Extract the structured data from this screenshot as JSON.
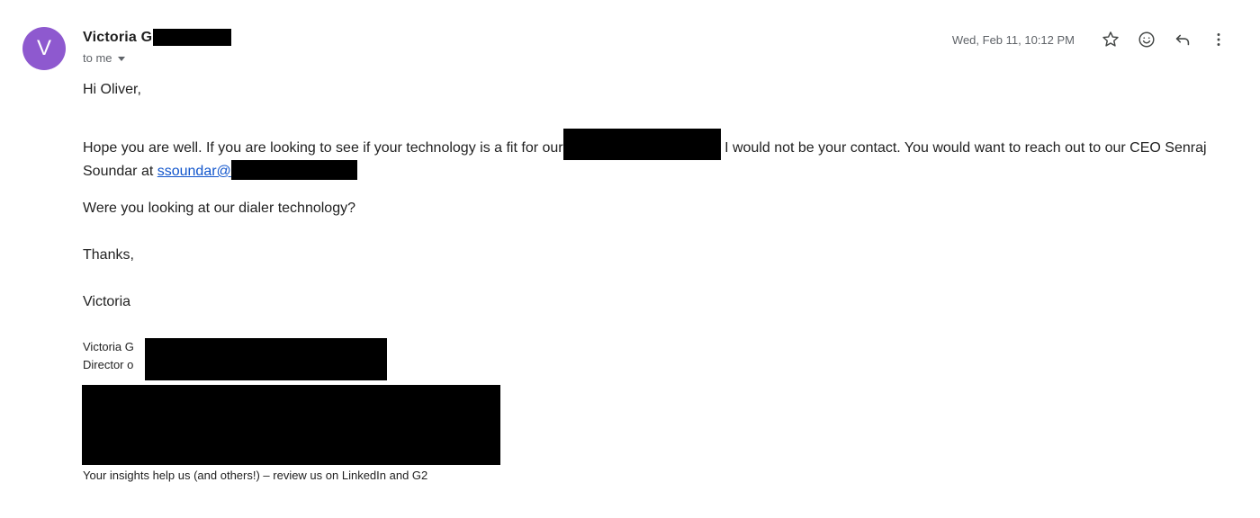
{
  "sender": {
    "avatar_letter": "V",
    "avatar_color": "#8e59cf",
    "name": "Victoria G",
    "to_label": "to me"
  },
  "header": {
    "timestamp": "Wed, Feb 11, 10:12 PM",
    "icons": [
      "star-icon",
      "emoji-icon",
      "reply-icon",
      "more-vert-icon"
    ]
  },
  "body": {
    "greeting": "Hi Oliver,",
    "main_part1": "Hope you are well.  If you are looking to see if your technology is a fit for our",
    "main_part2": "I would not be your contact.  You would want to reach out to our CEO Senraj Soundar at ",
    "email_link": "ssoundar@",
    "question": "Were you looking at our dialer technology?",
    "thanks": "Thanks,",
    "signoff": "Victoria"
  },
  "signature": {
    "name_line": "Victoria G",
    "title_line": "Director o",
    "footer": "Your insights help us (and others!) – review us on LinkedIn and G2"
  },
  "colors": {
    "link": "#1155cc",
    "muted": "#5f6368",
    "redaction": "#000000"
  }
}
